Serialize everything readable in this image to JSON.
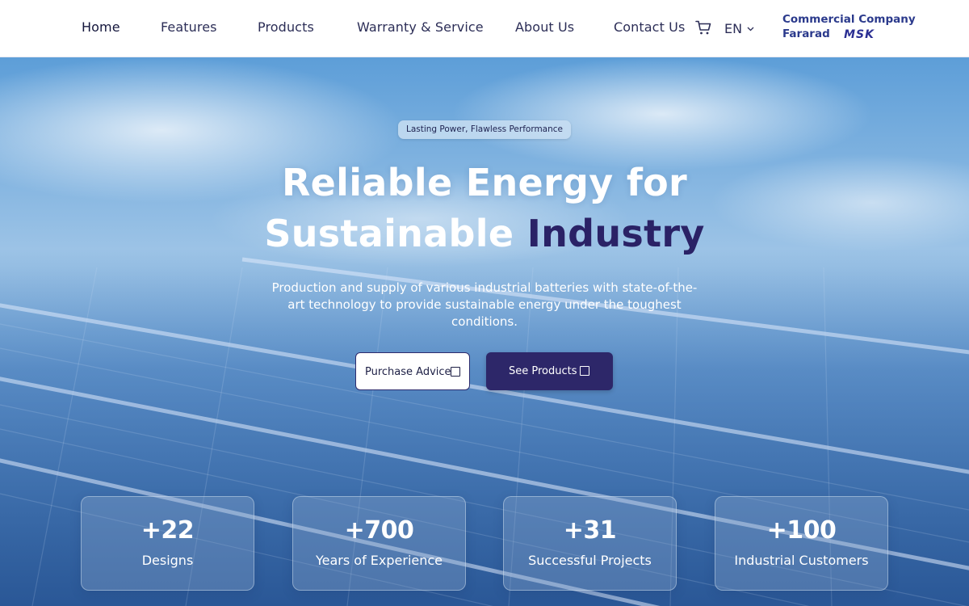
{
  "nav": {
    "items": [
      {
        "label": "Home"
      },
      {
        "label": "Features"
      },
      {
        "label": "Products"
      },
      {
        "label": "Warranty & Service"
      },
      {
        "label": "About Us"
      },
      {
        "label": "Contact Us"
      }
    ],
    "cart_icon": "cart-icon",
    "language": "EN",
    "language_icon": "chevron-down-icon"
  },
  "brand": {
    "line1": "Commercial Company",
    "line2": "Fararad",
    "logo_text": "MSK"
  },
  "hero": {
    "tagline": "Lasting Power, Flawless Performance",
    "title_line1": "Reliable Energy for",
    "title_line2_plain": "Sustainable",
    "title_line2_accent": "Industry",
    "description": "Production and supply of various industrial batteries with state-of-the-art technology to provide sustainable energy under the toughest conditions.",
    "buttons": {
      "purchase_advice": "Purchase Advice",
      "see_products": "See Products"
    }
  },
  "stats": [
    {
      "value": "+22",
      "label": "Designs"
    },
    {
      "value": "+700",
      "label": "Years of Experience"
    },
    {
      "value": "+31",
      "label": "Successful Projects"
    },
    {
      "value": "+100",
      "label": "Industrial Customers"
    }
  ],
  "colors": {
    "brand_dark": "#2d2769",
    "accent_text": "#2a2266",
    "nav_text": "#2c2e57",
    "brand_blue": "#2b3a8c"
  }
}
